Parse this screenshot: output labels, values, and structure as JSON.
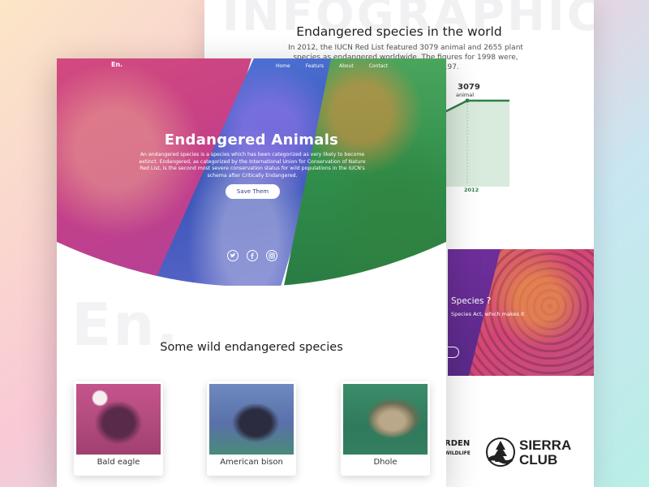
{
  "back_page": {
    "bg_word": "INFOGRAPHICS",
    "title": "Endangered species in the world",
    "description": "In 2012, the IUCN Red List featured 3079 animal and 2655 plant species as endangered worldwide. The figures for 1998 were, respectively, 1102 and 1197.",
    "chart_value": "3079",
    "chart_value_sub": "animal",
    "chart_year": "2012",
    "promo_title": "Species ?",
    "promo_sub": "Species Act, which makes it",
    "logos": {
      "nwf_line1": "RDEN",
      "nwf_line2": "WILDLIFE",
      "sierra_line1": "SIERRA",
      "sierra_line2": "CLUB"
    }
  },
  "front_page": {
    "logo": "En.",
    "nav": [
      "Home",
      "Featurs",
      "About",
      "Contact"
    ],
    "hero": {
      "title": "Endangered Animals",
      "description": "An endangered species is a species which has been categorized as very likely to become extinct. Endangered, as categorized by the International Union for Conservation of Nature Red List, is the second most severe conservation status for wild populations in the IUCN's schema after Critically Endangered.",
      "button": "Save Them"
    },
    "social": [
      "twitter-icon",
      "facebook-icon",
      "instagram-icon"
    ],
    "bg_word": "En.",
    "section_title": "Some wild endangered species",
    "cards": [
      {
        "label": "Bald eagle"
      },
      {
        "label": "American bison"
      },
      {
        "label": "Dhole"
      }
    ]
  },
  "colors": {
    "pink": "#c64087",
    "blue": "#3a55b8",
    "green": "#2f8d4a",
    "chart_green": "#2f7f4a"
  }
}
